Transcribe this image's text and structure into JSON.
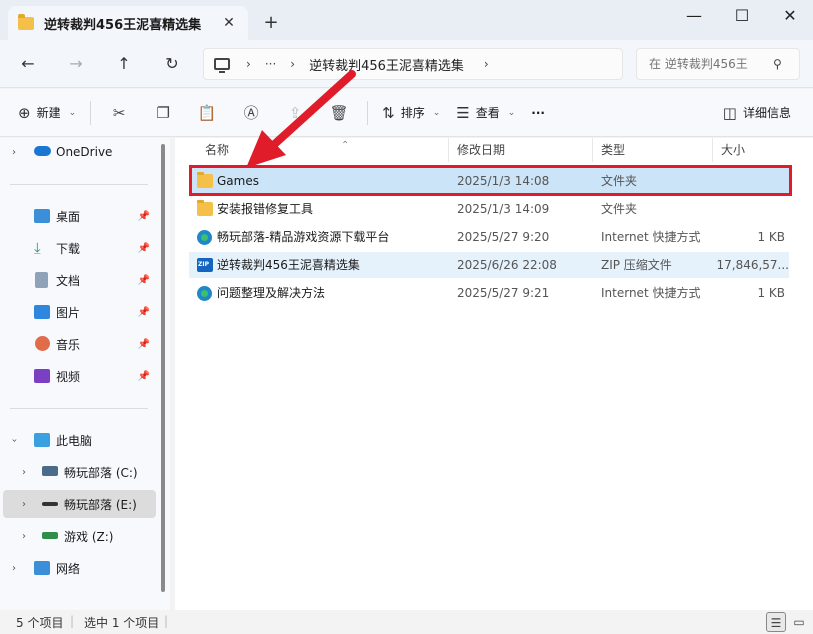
{
  "window": {
    "tab_title": "逆转裁判456王泥喜精选集",
    "tab_close": "✕",
    "new_tab": "+",
    "minimize": "—",
    "maximize": "☐",
    "close": "✕"
  },
  "address": {
    "more": "···",
    "crumb": "逆转裁判456王泥喜精选集",
    "search_placeholder": "在 逆转裁判456王"
  },
  "commands": {
    "new_label": "新建",
    "sort_label": "排序",
    "view_label": "查看",
    "more": "···",
    "details_label": "详细信息"
  },
  "sidebar": {
    "onedrive": "OneDrive",
    "quick": [
      {
        "label": "桌面"
      },
      {
        "label": "下载"
      },
      {
        "label": "文档"
      },
      {
        "label": "图片"
      },
      {
        "label": "音乐"
      },
      {
        "label": "视频"
      }
    ],
    "this_pc": "此电脑",
    "drives": [
      {
        "label": "畅玩部落 (C:)"
      },
      {
        "label": "畅玩部落 (E:)"
      },
      {
        "label": "游戏 (Z:)"
      }
    ],
    "network": "网络"
  },
  "columns": {
    "name": "名称",
    "modified": "修改日期",
    "type": "类型",
    "size": "大小"
  },
  "files": [
    {
      "name": "Games",
      "modified": "2025/1/3 14:08",
      "type": "文件夹",
      "size": ""
    },
    {
      "name": "安装报错修复工具",
      "modified": "2025/1/3 14:09",
      "type": "文件夹",
      "size": ""
    },
    {
      "name": "畅玩部落-精品游戏资源下载平台",
      "modified": "2025/5/27 9:20",
      "type": "Internet 快捷方式",
      "size": "1 KB"
    },
    {
      "name": "逆转裁判456王泥喜精选集",
      "modified": "2025/6/26 22:08",
      "type": "ZIP 压缩文件",
      "size": "17,846,57..."
    },
    {
      "name": "问题整理及解决方法",
      "modified": "2025/5/27 9:21",
      "type": "Internet 快捷方式",
      "size": "1 KB"
    }
  ],
  "status": {
    "count": "5 个项目",
    "selected": "选中 1 个项目"
  },
  "colors": {
    "highlight": "#e01c2a",
    "folder": "#f4c04a",
    "selection": "#cce4f7"
  }
}
